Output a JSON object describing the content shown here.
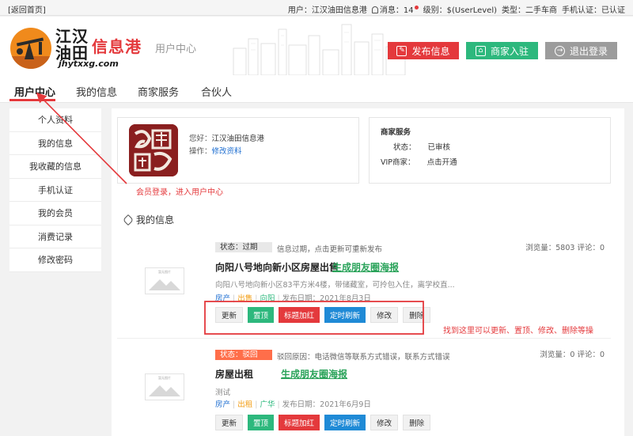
{
  "topbar": {
    "back_link": "[返回首页]",
    "user_label": "用户：",
    "user_name": "江汉油田信息港",
    "messages_label": "消息：",
    "messages_count": "14",
    "level_label": "级别：",
    "level_value": "$(UserLevel)",
    "type_label": "类型：",
    "type_value": "二手车商",
    "phone_label": "手机认证：",
    "phone_value": "已认证"
  },
  "header": {
    "logo_line1": "江汉",
    "logo_line2": "油田",
    "logo_brand": "信息港",
    "logo_url": "jhytxxg.com",
    "subtitle": "用户中心",
    "publish_button": "发布信息",
    "merchant_button": "商家入驻",
    "logout_button": "退出登录",
    "colors": {
      "publish": "#e4393c",
      "merchant": "#2db87d",
      "logout": "#9c9c9c"
    }
  },
  "nav": {
    "tabs": [
      {
        "label": "用户中心"
      },
      {
        "label": "我的信息"
      },
      {
        "label": "商家服务"
      },
      {
        "label": "合伙人"
      }
    ],
    "active_index": 0
  },
  "sidebar": {
    "items": [
      {
        "label": "个人资料"
      },
      {
        "label": "我的信息"
      },
      {
        "label": "我收藏的信息"
      },
      {
        "label": "手机认证"
      },
      {
        "label": "我的会员"
      },
      {
        "label": "消费记录"
      },
      {
        "label": "修改密码"
      }
    ]
  },
  "profile": {
    "greeting_label": "您好：",
    "greeting_name": "江汉油田信息港",
    "action_label": "操作：",
    "action_link": "修改资料"
  },
  "merchant_service": {
    "title": "商家服务",
    "status_label": "状态：",
    "status_value": "已审核",
    "vip_label": "VIP商家：",
    "vip_value": "点击开通"
  },
  "my_info_title": "我的信息",
  "thumb_placeholder": "暂无图片",
  "listings": [
    {
      "status": "状态：过期",
      "status_note": "信息过期，点击更新可重新发布",
      "stats": "浏览量：5803 评论：0",
      "title": "向阳八号地向新小区房屋出售",
      "poster_link": "生成朋友圈海报",
      "description": "向阳八号地向新小区83平方米4楼，带储藏室，可拎包入住，离学校直...",
      "tag1": "房产",
      "tag2": "出售",
      "tag3": "向阳",
      "date": "发布日期：2021年8月3日"
    },
    {
      "status": "状态：驳回",
      "status_note": "驳回原因：电话微信等联系方式错误，联系方式错误",
      "stats": "浏览量：0 评论：0",
      "title": "房屋出租",
      "poster_link": "生成朋友圈海报",
      "description": "测试",
      "tag1": "房产",
      "tag2": "出租",
      "tag3": "广华",
      "date": "发布日期：2021年6月9日"
    }
  ],
  "actions": {
    "refresh": "更新",
    "top": "置顶",
    "highlight": "标题加红",
    "scheduled": "定时刷新",
    "edit": "修改",
    "delete": "删除"
  },
  "annotations": {
    "login_note": "会员登录，进入用户中心",
    "actions_note": "找到这里可以更新、置顶、修改、删除等操"
  }
}
